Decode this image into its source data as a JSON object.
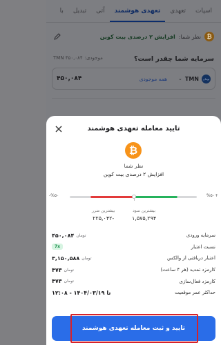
{
  "tabs": [
    {
      "label": "اسپات"
    },
    {
      "label": "تعهدی"
    },
    {
      "label": "تعهدی هوشمند"
    },
    {
      "label": "آتی"
    },
    {
      "label": "تبدیل"
    },
    {
      "label": "با"
    }
  ],
  "background": {
    "opinion_label": "نظر شما:",
    "opinion_value": "افزایش ۲ درصدی بیت کوین",
    "coin_symbol": "₿",
    "question": "سرمایه شما چقدر است؟",
    "balance_label": "موجودی:",
    "balance_value": "۴۵۰,۰۸۴ TMN",
    "currency": "TMN",
    "all_balance": "همه موجودی",
    "amount_value": "۴۵۰,۰۸۴",
    "tmn_icon_text": "تومان"
  },
  "modal": {
    "title": "تایید معامله تعهدی هوشمند",
    "coin_symbol": "₿",
    "opinion_title": "نظر شما",
    "opinion_value": "افزایش ۲ درصدی بیت کوین",
    "range_min": "-%۵۰",
    "range_max": "%۵۰+",
    "stop_loss_label": "بیشترین ضرر",
    "stop_loss_value": "۲۲۵,۰۴۲-",
    "take_profit_label": "بیشترین سود",
    "take_profit_value": "۱,۵۷۵,۲۹۴",
    "rows": [
      {
        "label": "سرمایه ورودی",
        "value": "۴۵۰,۰۸۴",
        "unit": "تومان"
      },
      {
        "label": "نسبت اعتبار",
        "value": "7x",
        "unit": ""
      },
      {
        "label": "اعتبار دریافتی از والکس",
        "value": "۳,۱۵۰,۵۸۸",
        "unit": "تومان"
      },
      {
        "label": "کارمزد تمدید (هر ۴ ساعت)",
        "value": "۴۷۳",
        "unit": "تومان"
      },
      {
        "label": "کارمزد فعال‌سازی",
        "value": "۴۷۳",
        "unit": "تومان"
      },
      {
        "label": "حداکثر عمر موقعیت",
        "value": "تا ۱۴۰۴/۰۳/۱۹ - ۱۲:۰۸",
        "unit": ""
      }
    ],
    "confirm_label": "تایید و ثبت معامله تعهدی هوشمند"
  },
  "colors": {
    "primary": "#2a6de8",
    "loss": "#e23a3a",
    "profit": "#25b25c",
    "bitcoin": "#f7931a",
    "highlight": "#d6222a"
  }
}
